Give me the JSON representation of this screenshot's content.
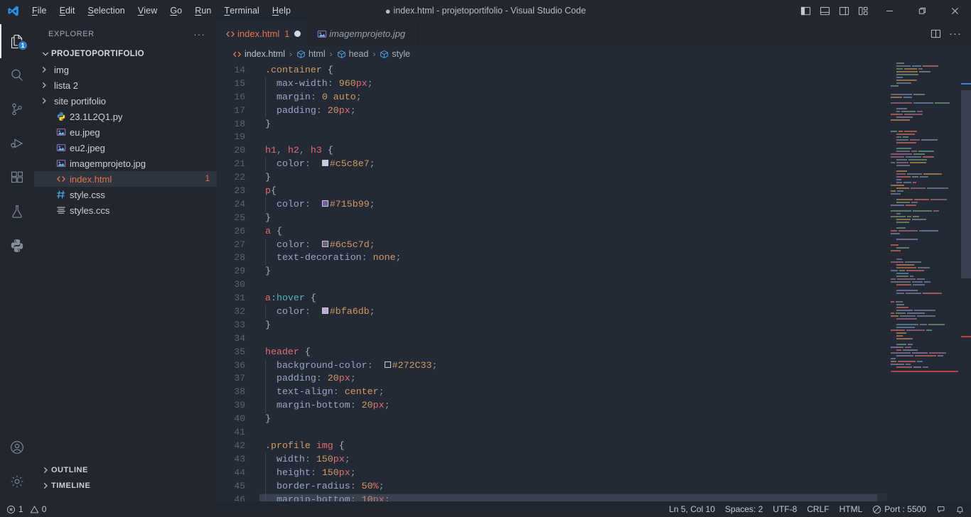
{
  "window": {
    "title_prefix": "●",
    "title": "index.html - projetoportifolio - Visual Studio Code"
  },
  "menu": {
    "items": [
      {
        "accel": "F",
        "rest": "ile"
      },
      {
        "accel": "E",
        "rest": "dit"
      },
      {
        "accel": "S",
        "rest": "election"
      },
      {
        "accel": "V",
        "rest": "iew"
      },
      {
        "accel": "G",
        "rest": "o"
      },
      {
        "accel": "R",
        "rest": "un"
      },
      {
        "accel": "T",
        "rest": "erminal"
      },
      {
        "accel": "H",
        "rest": "elp"
      }
    ]
  },
  "titlebar_icons": {
    "toggle_primary_sidebar": "layout-sidebar-left-icon",
    "toggle_panel": "layout-panel-icon",
    "toggle_secondary_sidebar": "layout-sidebar-right-icon",
    "customize_layout": "customize-layout-icon",
    "minimize": "minimize-icon",
    "restore": "restore-icon",
    "close": "close-icon"
  },
  "activitybar": {
    "items": [
      {
        "name": "explorer",
        "icon": "files-icon",
        "badge": "1",
        "active": true
      },
      {
        "name": "search",
        "icon": "search-icon",
        "badge": "",
        "active": false
      },
      {
        "name": "source-control",
        "icon": "source-control-icon",
        "badge": "",
        "active": false
      },
      {
        "name": "run-and-debug",
        "icon": "run-debug-icon",
        "badge": "",
        "active": false
      },
      {
        "name": "extensions",
        "icon": "extensions-icon",
        "badge": "",
        "active": false
      },
      {
        "name": "testing",
        "icon": "beaker-icon",
        "badge": "",
        "active": false
      },
      {
        "name": "python",
        "icon": "python-icon",
        "badge": "",
        "active": false
      }
    ],
    "bottom": [
      {
        "name": "accounts",
        "icon": "account-icon"
      },
      {
        "name": "manage",
        "icon": "gear-icon"
      }
    ]
  },
  "sidebar": {
    "header": "EXPLORER",
    "more_actions": "···",
    "folder": "PROJETOPORTIFOLIO",
    "files": [
      {
        "name": "img",
        "type": "folder",
        "icon": "chevron-right-icon",
        "count": ""
      },
      {
        "name": "lista 2",
        "type": "folder",
        "icon": "chevron-right-icon",
        "count": ""
      },
      {
        "name": "site portifolio",
        "type": "folder",
        "icon": "chevron-right-icon",
        "count": ""
      },
      {
        "name": "23.1L2Q1.py",
        "type": "python",
        "icon": "python-file-icon",
        "count": ""
      },
      {
        "name": "eu.jpeg",
        "type": "image",
        "icon": "image-file-icon",
        "count": ""
      },
      {
        "name": "eu2.jpeg",
        "type": "image",
        "icon": "image-file-icon",
        "count": ""
      },
      {
        "name": "imagemprojeto.jpg",
        "type": "image",
        "icon": "image-file-icon",
        "count": ""
      },
      {
        "name": "index.html",
        "type": "html",
        "icon": "html-file-icon",
        "count": "1",
        "selected": true
      },
      {
        "name": "style.css",
        "type": "css",
        "icon": "css-file-icon",
        "count": ""
      },
      {
        "name": "styles.ccs",
        "type": "text",
        "icon": "text-file-icon",
        "count": ""
      }
    ],
    "sections": [
      {
        "label": "OUTLINE",
        "expanded": false
      },
      {
        "label": "TIMELINE",
        "expanded": false
      }
    ]
  },
  "tabs": [
    {
      "label": "index.html",
      "icon": "html-file-icon",
      "count": "1",
      "dirty": true,
      "active": true,
      "italic": false
    },
    {
      "label": "imagemprojeto.jpg",
      "icon": "image-file-icon",
      "count": "",
      "dirty": false,
      "active": false,
      "italic": true
    }
  ],
  "editor_actions": [
    {
      "name": "split-editor-right",
      "icon": "split-editor-icon"
    },
    {
      "name": "more-actions",
      "icon": "ellipsis-icon",
      "label": "···"
    }
  ],
  "breadcrumb": [
    {
      "label": "index.html",
      "icon": "html-file-icon"
    },
    {
      "label": "html",
      "icon": "symbol-class-icon"
    },
    {
      "label": "head",
      "icon": "symbol-class-icon"
    },
    {
      "label": "style",
      "icon": "symbol-class-icon"
    }
  ],
  "breadcrumb_separator": "›",
  "code": {
    "first_line": 14,
    "cursor_line_index": 32,
    "lines": [
      {
        "n": 14,
        "tokens": [
          {
            "t": ".container ",
            "c": "sel2"
          },
          {
            "t": "{",
            "c": "brace"
          }
        ],
        "indent": 0
      },
      {
        "n": 15,
        "tokens": [
          {
            "t": "  max-width",
            "c": "prop"
          },
          {
            "t": ": ",
            "c": "punc"
          },
          {
            "t": "960",
            "c": "num"
          },
          {
            "t": "px",
            "c": "unit"
          },
          {
            "t": ";",
            "c": "punc"
          }
        ],
        "indent": 1
      },
      {
        "n": 16,
        "tokens": [
          {
            "t": "  margin",
            "c": "prop"
          },
          {
            "t": ": ",
            "c": "punc"
          },
          {
            "t": "0",
            "c": "num"
          },
          {
            "t": " auto",
            "c": "val"
          },
          {
            "t": ";",
            "c": "punc"
          }
        ],
        "indent": 1
      },
      {
        "n": 17,
        "tokens": [
          {
            "t": "  padding",
            "c": "prop"
          },
          {
            "t": ": ",
            "c": "punc"
          },
          {
            "t": "20",
            "c": "num"
          },
          {
            "t": "px",
            "c": "unit"
          },
          {
            "t": ";",
            "c": "punc"
          }
        ],
        "indent": 1
      },
      {
        "n": 18,
        "tokens": [
          {
            "t": "}",
            "c": "brace"
          }
        ],
        "indent": 0
      },
      {
        "n": 19,
        "tokens": [],
        "indent": 0
      },
      {
        "n": 20,
        "tokens": [
          {
            "t": "h1",
            "c": "sel"
          },
          {
            "t": ", ",
            "c": "punc"
          },
          {
            "t": "h2",
            "c": "sel"
          },
          {
            "t": ", ",
            "c": "punc"
          },
          {
            "t": "h3",
            "c": "sel"
          },
          {
            "t": " {",
            "c": "brace"
          }
        ],
        "indent": 0
      },
      {
        "n": 21,
        "tokens": [
          {
            "t": "  color",
            "c": "prop"
          },
          {
            "t": ":  ",
            "c": "punc"
          },
          {
            "t": "#c5c8e7",
            "c": "val",
            "swatch": "#c5c8e7"
          },
          {
            "t": ";",
            "c": "punc"
          }
        ],
        "indent": 1
      },
      {
        "n": 22,
        "tokens": [
          {
            "t": "}",
            "c": "brace"
          }
        ],
        "indent": 0
      },
      {
        "n": 23,
        "tokens": [
          {
            "t": "p",
            "c": "sel"
          },
          {
            "t": "{",
            "c": "brace"
          }
        ],
        "indent": 0
      },
      {
        "n": 24,
        "tokens": [
          {
            "t": "  color",
            "c": "prop"
          },
          {
            "t": ":  ",
            "c": "punc"
          },
          {
            "t": "#715b99",
            "c": "val",
            "swatch": "#715b99"
          },
          {
            "t": ";",
            "c": "punc"
          }
        ],
        "indent": 1
      },
      {
        "n": 25,
        "tokens": [
          {
            "t": "}",
            "c": "brace"
          }
        ],
        "indent": 0
      },
      {
        "n": 26,
        "tokens": [
          {
            "t": "a",
            "c": "sel"
          },
          {
            "t": " {",
            "c": "brace"
          }
        ],
        "indent": 0
      },
      {
        "n": 27,
        "tokens": [
          {
            "t": "  color",
            "c": "prop"
          },
          {
            "t": ":  ",
            "c": "punc"
          },
          {
            "t": "#6c5c7d",
            "c": "val",
            "swatch": "#6c5c7d"
          },
          {
            "t": ";",
            "c": "punc"
          }
        ],
        "indent": 1
      },
      {
        "n": 28,
        "tokens": [
          {
            "t": "  text-decoration",
            "c": "prop"
          },
          {
            "t": ": ",
            "c": "punc"
          },
          {
            "t": "none",
            "c": "val"
          },
          {
            "t": ";",
            "c": "punc"
          }
        ],
        "indent": 1
      },
      {
        "n": 29,
        "tokens": [
          {
            "t": "}",
            "c": "brace"
          }
        ],
        "indent": 0
      },
      {
        "n": 30,
        "tokens": [],
        "indent": 0
      },
      {
        "n": 31,
        "tokens": [
          {
            "t": "a",
            "c": "sel"
          },
          {
            "t": ":hover",
            "c": "pseudo"
          },
          {
            "t": " {",
            "c": "brace"
          }
        ],
        "indent": 0
      },
      {
        "n": 32,
        "tokens": [
          {
            "t": "  color",
            "c": "prop"
          },
          {
            "t": ":  ",
            "c": "punc"
          },
          {
            "t": "#bfa6db",
            "c": "val",
            "swatch": "#bfa6db"
          },
          {
            "t": ";",
            "c": "punc"
          }
        ],
        "indent": 1
      },
      {
        "n": 33,
        "tokens": [
          {
            "t": "}",
            "c": "brace"
          }
        ],
        "indent": 0
      },
      {
        "n": 34,
        "tokens": [],
        "indent": 0
      },
      {
        "n": 35,
        "tokens": [
          {
            "t": "header",
            "c": "sel"
          },
          {
            "t": " {",
            "c": "brace"
          }
        ],
        "indent": 0
      },
      {
        "n": 36,
        "tokens": [
          {
            "t": "  background-color",
            "c": "prop"
          },
          {
            "t": ":  ",
            "c": "punc"
          },
          {
            "t": "#272C33",
            "c": "val",
            "swatch": "#272C33"
          },
          {
            "t": ";",
            "c": "punc"
          }
        ],
        "indent": 1
      },
      {
        "n": 37,
        "tokens": [
          {
            "t": "  padding",
            "c": "prop"
          },
          {
            "t": ": ",
            "c": "punc"
          },
          {
            "t": "20",
            "c": "num"
          },
          {
            "t": "px",
            "c": "unit"
          },
          {
            "t": ";",
            "c": "punc"
          }
        ],
        "indent": 1
      },
      {
        "n": 38,
        "tokens": [
          {
            "t": "  text-align",
            "c": "prop"
          },
          {
            "t": ": ",
            "c": "punc"
          },
          {
            "t": "center",
            "c": "val"
          },
          {
            "t": ";",
            "c": "punc"
          }
        ],
        "indent": 1
      },
      {
        "n": 39,
        "tokens": [
          {
            "t": "  margin-bottom",
            "c": "prop"
          },
          {
            "t": ": ",
            "c": "punc"
          },
          {
            "t": "20",
            "c": "num"
          },
          {
            "t": "px",
            "c": "unit"
          },
          {
            "t": ";",
            "c": "punc"
          }
        ],
        "indent": 1
      },
      {
        "n": 40,
        "tokens": [
          {
            "t": "}",
            "c": "brace"
          }
        ],
        "indent": 0
      },
      {
        "n": 41,
        "tokens": [],
        "indent": 0
      },
      {
        "n": 42,
        "tokens": [
          {
            "t": ".profile ",
            "c": "sel2"
          },
          {
            "t": "img",
            "c": "sel"
          },
          {
            "t": " {",
            "c": "brace"
          }
        ],
        "indent": 0
      },
      {
        "n": 43,
        "tokens": [
          {
            "t": "  width",
            "c": "prop"
          },
          {
            "t": ": ",
            "c": "punc"
          },
          {
            "t": "150",
            "c": "num"
          },
          {
            "t": "px",
            "c": "unit"
          },
          {
            "t": ";",
            "c": "punc"
          }
        ],
        "indent": 1
      },
      {
        "n": 44,
        "tokens": [
          {
            "t": "  height",
            "c": "prop"
          },
          {
            "t": ": ",
            "c": "punc"
          },
          {
            "t": "150",
            "c": "num"
          },
          {
            "t": "px",
            "c": "unit"
          },
          {
            "t": ";",
            "c": "punc"
          }
        ],
        "indent": 1
      },
      {
        "n": 45,
        "tokens": [
          {
            "t": "  border-radius",
            "c": "prop"
          },
          {
            "t": ": ",
            "c": "punc"
          },
          {
            "t": "50",
            "c": "num"
          },
          {
            "t": "%",
            "c": "unit"
          },
          {
            "t": ";",
            "c": "punc"
          }
        ],
        "indent": 1
      },
      {
        "n": 46,
        "tokens": [
          {
            "t": "  margin-bottom",
            "c": "prop"
          },
          {
            "t": ": ",
            "c": "punc"
          },
          {
            "t": "10",
            "c": "num"
          },
          {
            "t": "px",
            "c": "unit"
          },
          {
            "t": ";",
            "c": "punc"
          }
        ],
        "indent": 1
      }
    ]
  },
  "statusbar": {
    "left": [
      {
        "name": "errors",
        "icon": "error-icon",
        "label": "1"
      },
      {
        "name": "warnings",
        "icon": "warning-icon",
        "label": "0"
      }
    ],
    "right": [
      {
        "name": "cursor-position",
        "label": "Ln 5, Col 10"
      },
      {
        "name": "indentation",
        "label": "Spaces: 2"
      },
      {
        "name": "encoding",
        "label": "UTF-8"
      },
      {
        "name": "eol",
        "label": "CRLF"
      },
      {
        "name": "language-mode",
        "label": "HTML"
      },
      {
        "name": "live-server-port",
        "label": "Port : 5500",
        "icon": "radio-tower-icon"
      },
      {
        "name": "feedback",
        "label": "",
        "icon": "feedback-icon"
      },
      {
        "name": "notifications",
        "label": "",
        "icon": "bell-icon"
      }
    ]
  },
  "colors": {
    "titlebar_bg": "#22262e",
    "sidebar_bg": "#22262e",
    "editor_bg": "#242a35",
    "accent_orange": "#e8734a",
    "badge_blue": "#2f7fd1"
  }
}
